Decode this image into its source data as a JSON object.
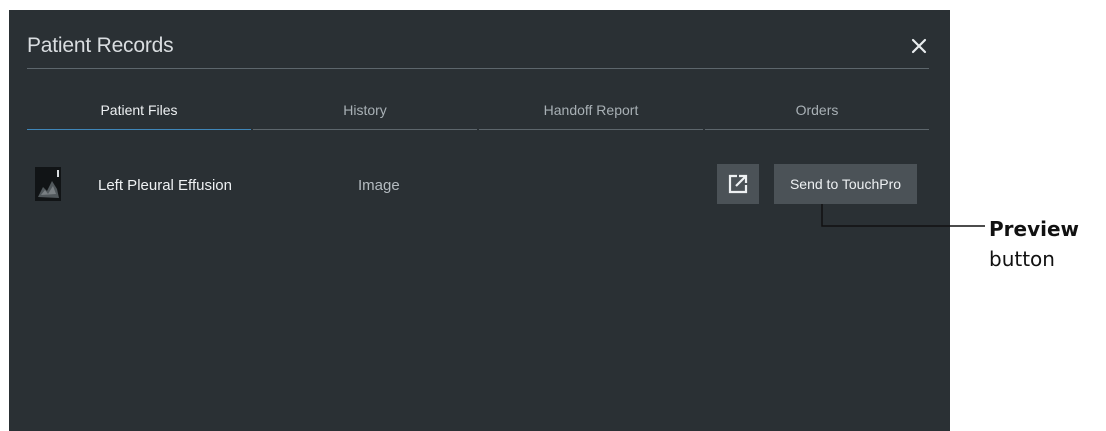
{
  "dialog": {
    "title": "Patient Records",
    "close_icon": "close-icon"
  },
  "tabs": [
    {
      "label": "Patient Files",
      "active": true
    },
    {
      "label": "History",
      "active": false
    },
    {
      "label": "Handoff Report",
      "active": false
    },
    {
      "label": "Orders",
      "active": false
    }
  ],
  "files": [
    {
      "thumbnail": "xray-thumbnail",
      "name": "Left Pleural Effusion",
      "type": "Image",
      "preview_icon": "open-external-icon",
      "send_label": "Send to TouchPro"
    }
  ],
  "callout": {
    "title": "Preview",
    "subtitle": "button"
  },
  "colors": {
    "dialog_bg": "#2a3034",
    "button_bg": "#4b5257",
    "active_tab_underline": "#3f86b8"
  }
}
